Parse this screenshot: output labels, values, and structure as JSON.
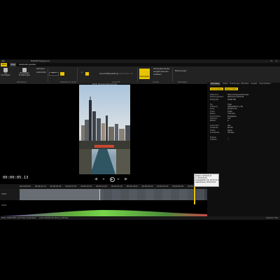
{
  "titlebar": {
    "app": "ARL",
    "title": "ELEVATE Playground",
    "window_controls": "– ❐ ✕"
  },
  "tabs": [
    {
      "label": "Start",
      "style": "hl"
    },
    {
      "label": "Clips",
      "style": "act"
    },
    {
      "label": "Bearbeitungsdatei",
      "style": ""
    }
  ],
  "ribbon": {
    "buttons": [
      {
        "label": "Clip hinzufügen"
      },
      {
        "label": "Hinzufügen Einstellungen"
      },
      {
        "label": "Aktivieren"
      },
      {
        "label": "Ausblenden"
      }
    ],
    "field_value": "100 %",
    "groups": [
      "Bearbeitung",
      "Zeitleiste und Objekt",
      "Ausschnitt",
      "Anzeige",
      "Wiedergabe"
    ],
    "mid_labels": [
      "Ausschnittbearbeitung",
      "Ausschnitt in ms"
    ],
    "yellow_label": "Wiedergabe",
    "right_labels": [
      "Wiedergabe starten",
      "Ausgabe beenden",
      "Loslassen"
    ],
    "far_right": "Markierungen"
  },
  "video": {
    "title": "9X16_Chicago-Vertical.mp4"
  },
  "transport": {
    "timecode": "00:00:05.13",
    "prev": "◀ ◂",
    "play": "▶",
    "next": "▸ ▶"
  },
  "right_panel": {
    "tabs": [
      "Information",
      "Details",
      "Einstellungen",
      "Metadaten",
      "Ausgabe",
      "Originaldateien"
    ],
    "buttons": [
      "Clip eingeben",
      "Eigenschaften"
    ],
    "properties": [
      {
        "k": "Dateiname",
        "v": "9X16_Chicago-Vertical.mp4"
      },
      {
        "k": "Erstellungsdatum",
        "v": "2023-07-19 16:02:44"
      },
      {
        "k": "Dateigröße",
        "v": "28.887 MB"
      },
      {
        "k": "",
        "v": ""
      },
      {
        "k": "Typ",
        "v": "Video"
      },
      {
        "k": "Auflösung",
        "v": "1080x1920 (1:1.78)"
      },
      {
        "k": "Dauer",
        "v": "00:00:32.10"
      },
      {
        "k": "Codec",
        "v": "H.264"
      },
      {
        "k": "Bitrate",
        "v": "7153 kb/s"
      },
      {
        "k": "Frame-Modus",
        "v": "Progressive"
      },
      {
        "k": "Farbraum",
        "v": "YUV"
      },
      {
        "k": "Bittiefe",
        "v": "8"
      },
      {
        "k": "",
        "v": ""
      },
      {
        "k": "Audiocodec",
        "v": "AAC"
      },
      {
        "k": "Abtastrate",
        "v": "48 kHz"
      },
      {
        "k": "Kanäle",
        "v": "Stereo"
      },
      {
        "k": "Audiobitrate",
        "v": "128 kb/s"
      },
      {
        "k": "",
        "v": ""
      },
      {
        "k": "Ersteller",
        "v": "—"
      },
      {
        "k": "Software",
        "v": "—"
      }
    ]
  },
  "timeline": {
    "ticks": [
      "00:00:00.00",
      "00:00:02.15",
      "00:00:05.05",
      "00:00:07.20",
      "00:00:10.10",
      "00:00:13.00",
      "00:00:15.15",
      "00:00:18.05",
      "00:00:20.20",
      "00:00:23.10",
      "00:00:26.00",
      "00:00:28.15"
    ],
    "track_label": "VIDEO",
    "audio_label": "AUDIO",
    "tooltip": {
      "line1": "Position: 00:00:05.13",
      "line2": "In: 00:00:00.00",
      "line3": "Ausgewählter Clip: 00:00:32.10",
      "line4": "Gesamtdauer: 00:00:32.10"
    }
  },
  "statusbar": {
    "left": "Bilder: 1080x1920 | 29.97 fps | Progressive",
    "mid": "Audio: 48.000 Hz | Stereo | 128 kb/s",
    "right": "Speicher: 34%"
  },
  "colors": {
    "accent": "#e8c400",
    "background": "#000000",
    "panel": "#0f0f0f"
  }
}
